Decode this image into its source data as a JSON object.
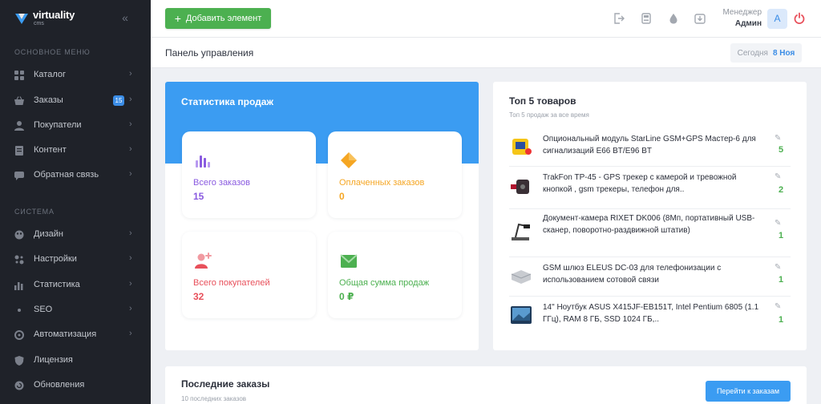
{
  "brand": {
    "name": "virtuality",
    "sub": "cms"
  },
  "sidebar": {
    "section_main": "Основное меню",
    "section_system": "Система",
    "main_items": [
      {
        "label": "Каталог"
      },
      {
        "label": "Заказы",
        "badge": "15"
      },
      {
        "label": "Покупатели"
      },
      {
        "label": "Контент"
      },
      {
        "label": "Обратная связь"
      }
    ],
    "system_items": [
      {
        "label": "Дизайн"
      },
      {
        "label": "Настройки"
      },
      {
        "label": "Статистика"
      },
      {
        "label": "SEO"
      },
      {
        "label": "Автоматизация"
      },
      {
        "label": "Лицензия"
      },
      {
        "label": "Обновления"
      }
    ]
  },
  "header": {
    "add_button": "Добавить элемент",
    "manager_role": "Менеджер",
    "manager_name": "Админ",
    "avatar_letter": "А"
  },
  "subheader": {
    "title": "Панель управления",
    "date_label": "Сегодня",
    "date_value": "8 Ноя"
  },
  "sales": {
    "title": "Статистика продаж",
    "cards": [
      {
        "label": "Всего заказов",
        "value": "15",
        "color": "#8a5be0",
        "icon": "bar-chart-icon"
      },
      {
        "label": "Оплаченных заказов",
        "value": "0",
        "color": "#f5a623",
        "icon": "diamond-icon"
      },
      {
        "label": "Всего покупателей",
        "value": "32",
        "color": "#e8505b",
        "icon": "user-add-icon"
      },
      {
        "label": "Общая сумма продаж",
        "value": "0 ₽",
        "color": "#4cb050",
        "icon": "envelope-icon"
      }
    ]
  },
  "top": {
    "title": "Топ 5 товаров",
    "subtitle": "Топ 5 продаж за все время",
    "items": [
      {
        "name": "Опциональный модуль StarLine GSM+GPS Мастер-6 для сигнализаций E66 BT/E96 BT",
        "count": "5"
      },
      {
        "name": "TrakFon TP-45 - GPS трекер с камерой и тревожной кнопкой , gsm трекеры, телефон для..",
        "count": "2"
      },
      {
        "name": "Документ-камера RIXET DK006 (8Мп, портативный USB-сканер, поворотно-раздвижной штатив)",
        "count": "1"
      },
      {
        "name": "GSM шлюз ELEUS DC-03 для телефонизации с использованием сотовой связи",
        "count": "1"
      },
      {
        "name": "14\" Ноутбук ASUS X415JF-EB151T, Intel Pentium 6805 (1.1 ГГц), RAM 8 ГБ, SSD 1024 ГБ,..",
        "count": "1"
      }
    ]
  },
  "orders": {
    "title": "Последние заказы",
    "subtitle": "10 последних заказов",
    "button": "Перейти к заказам"
  },
  "colors": {
    "sidebar_bg": "#1f2229",
    "accent_blue": "#3b9cf2",
    "accent_green": "#4cb050"
  }
}
